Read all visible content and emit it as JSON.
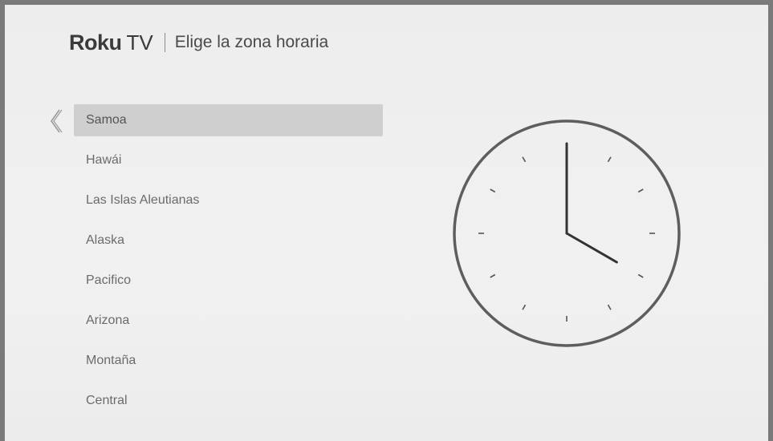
{
  "header": {
    "brand": "Roku",
    "brand_tv": "TV",
    "title": "Elige la zona horaria"
  },
  "back_icon": "chevron-left-icon",
  "timezones": [
    {
      "label": "Samoa",
      "selected": true
    },
    {
      "label": "Hawái",
      "selected": false
    },
    {
      "label": "Las Islas Aleutianas",
      "selected": false
    },
    {
      "label": "Alaska",
      "selected": false
    },
    {
      "label": "Pacifico",
      "selected": false
    },
    {
      "label": "Arizona",
      "selected": false
    },
    {
      "label": "Montaña",
      "selected": false
    },
    {
      "label": "Central",
      "selected": false
    }
  ],
  "clock": {
    "icon": "clock-icon",
    "time": "4:00"
  },
  "colors": {
    "selection": "#cfcfcf",
    "frame": "#7a7a7a",
    "background": "#efefef"
  }
}
